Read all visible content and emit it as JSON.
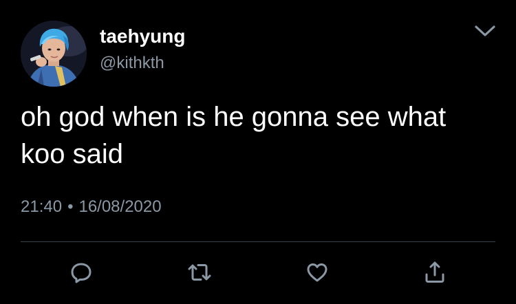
{
  "tweet": {
    "display_name": "taehyung",
    "handle": "@kithkth",
    "text": "oh god when is he gonna see what koo said",
    "time": "21:40",
    "separator": "•",
    "date": "16/08/2020"
  },
  "icons": {
    "menu": "chevron-down-icon",
    "reply": "reply-icon",
    "retweet": "retweet-icon",
    "like": "heart-icon",
    "share": "share-icon"
  },
  "colors": {
    "background": "#000000",
    "primary_text": "#ffffff",
    "secondary_text": "#8b98a5",
    "divider": "#38444d"
  }
}
